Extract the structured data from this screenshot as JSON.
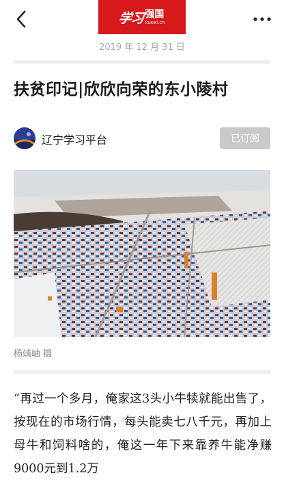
{
  "nav": {
    "back_icon": "back-arrow-icon",
    "more_icon": "more-dots-icon",
    "logo_script": "学习",
    "logo_text": "强国",
    "logo_url": "xuexi.cn",
    "brand_color": "#d7191c"
  },
  "article": {
    "date": "2019 年 12 月 31 日",
    "title": "扶贫印记|欣欣向荣的东小陵村",
    "author": "辽宁学习平台",
    "subscribe_label": "已订阅",
    "photo_caption": "杨靖岫 摄",
    "body": "“再过一个多月，俺家这3头小牛犊就能出售了，按现在的市场行情，每头能卖七八千元，再加上母牛和饲料啥的，俺这一年下来靠养牛能净赚9000元到1.2万"
  }
}
